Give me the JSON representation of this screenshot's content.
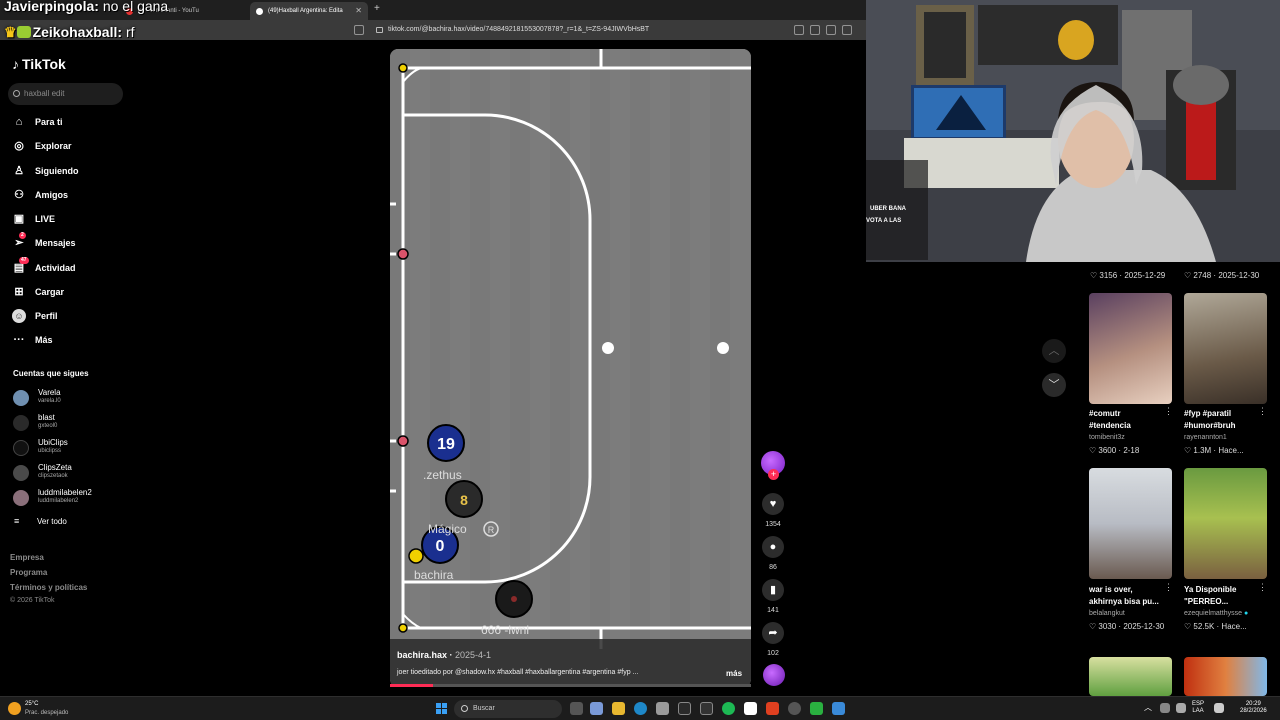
{
  "browser": {
    "tabs": [
      {
        "label": "ne - climesanti - YouTu",
        "active": false
      },
      {
        "label": "(49)Haxball Argentina: Edita",
        "active": true
      }
    ],
    "url": "tiktok.com/@bachira.hax/video/7488492181553007878?_r=1&_t=ZS-94JIWVbHsBT"
  },
  "chat_overlay": [
    {
      "user": "Javierpingola",
      "message": "no el gana"
    },
    {
      "user": "Zeikohaxball",
      "message": "rf"
    }
  ],
  "sidebar": {
    "logo": "TikTok",
    "search_placeholder": "haxball edit",
    "nav": [
      {
        "label": "Para ti",
        "icon": "home-icon"
      },
      {
        "label": "Explorar",
        "icon": "compass-icon"
      },
      {
        "label": "Siguiendo",
        "icon": "following-icon"
      },
      {
        "label": "Amigos",
        "icon": "friends-icon"
      },
      {
        "label": "LIVE",
        "icon": "live-icon"
      },
      {
        "label": "Mensajes",
        "icon": "messages-icon",
        "badge": "2"
      },
      {
        "label": "Actividad",
        "icon": "activity-icon",
        "badge": "47"
      },
      {
        "label": "Cargar",
        "icon": "upload-icon"
      },
      {
        "label": "Perfil",
        "icon": "profile-icon"
      },
      {
        "label": "Más",
        "icon": "more-icon"
      }
    ],
    "following_title": "Cuentas que sigues",
    "following": [
      {
        "name": "Varela",
        "handle": "varela.l0"
      },
      {
        "name": "blast",
        "handle": "gxteol0"
      },
      {
        "name": "UbiClips",
        "handle": "ubiclipss"
      },
      {
        "name": "ClipsZeta",
        "handle": "clipszetaok"
      },
      {
        "name": "luddmilabelen2",
        "handle": "luddmilabelen2"
      }
    ],
    "see_all": "Ver todo",
    "footer": [
      "Empresa",
      "Programa",
      "Términos y políticas"
    ],
    "copyright": "© 2026 TikTok"
  },
  "video": {
    "author": "bachira.hax",
    "date": "2025-4-1",
    "caption": "joer tioeditado por @shadow.hx #haxball #haxballargentina #argentina #fyp ...",
    "more": "más",
    "progress": 0.12,
    "players": [
      {
        "number": "19",
        "name": ".zethus",
        "color": "#1a2f8f"
      },
      {
        "number": "8",
        "name": "Mágico",
        "color": "#2a2a2a"
      },
      {
        "number": "0",
        "name": "bachira",
        "color": "#1a2f8f"
      },
      {
        "number": "",
        "name": "666 -lwnl",
        "color": "#1a1a1a"
      }
    ],
    "ball_tag": "R"
  },
  "actions": {
    "likes": "1354",
    "comments": "86",
    "saves": "141",
    "shares": "102"
  },
  "webcam_chat": [
    {
      "text": "UBER BANA"
    },
    {
      "text": "VOTA A LAS"
    }
  ],
  "recommended": {
    "top_stats": [
      {
        "likes": "3156",
        "date": "2025-12-29"
      },
      {
        "likes": "2748",
        "date": "2025-12-30"
      }
    ],
    "items": [
      {
        "title1": "#comutr",
        "title2": "#tendencia",
        "user": "tomibenit3z",
        "likes": "3600",
        "date": "2-18"
      },
      {
        "title1": "#fyp #paratil",
        "title2": "#humor#bruh",
        "user": "rayenannton1",
        "likes": "1.3M",
        "date": "Hace..."
      },
      {
        "title1": "war is over,",
        "title2": "akhirnya bisa pu...",
        "user": "belalangkut",
        "likes": "3030",
        "date": "2025-12-30"
      },
      {
        "title1": "Ya Disponible",
        "title2": "\"PERREO...",
        "user": "ezequielmatthysse",
        "likes": "52.5K",
        "date": "Hace..."
      }
    ]
  },
  "taskbar": {
    "temp": "25°C",
    "weather": "Prac. despejado",
    "search": "Buscar",
    "lang1": "ESP",
    "lang2": "LAA",
    "time": "20:29",
    "date": "28/2/2026"
  }
}
